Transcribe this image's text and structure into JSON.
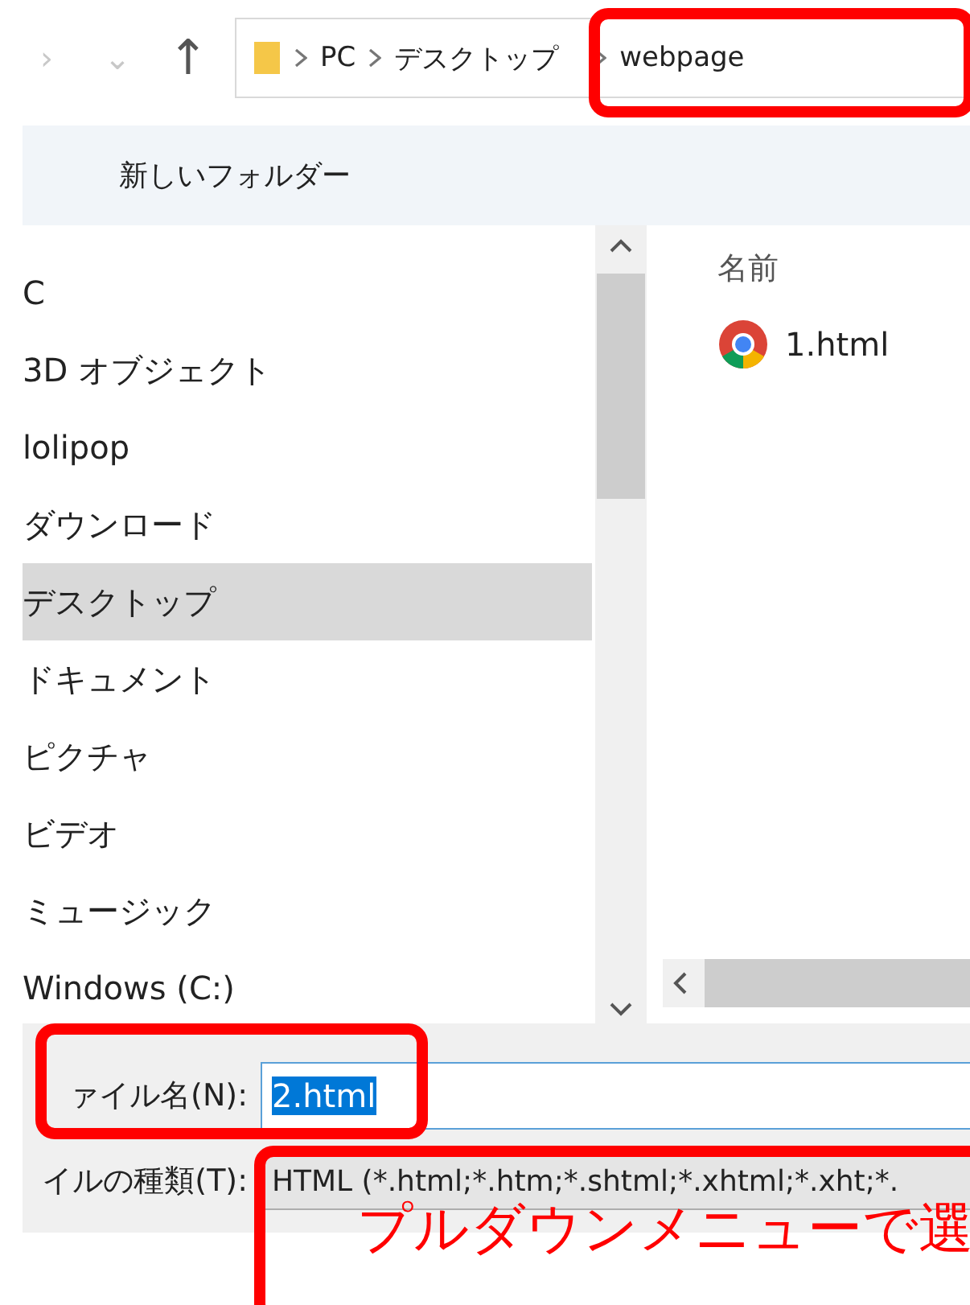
{
  "nav_buttons": {
    "back": "›",
    "forward": "⌄",
    "up": "↑"
  },
  "address_bar": {
    "segments": [
      {
        "label": "PC"
      },
      {
        "label": "デスクトップ"
      },
      {
        "label": "webpage"
      }
    ]
  },
  "toolbar": {
    "new_folder": "新しいフォルダー"
  },
  "nav_pane": {
    "items": [
      {
        "label": "C",
        "selected": false
      },
      {
        "label": "3D オブジェクト",
        "selected": false
      },
      {
        "label": "lolipop",
        "selected": false
      },
      {
        "label": "ダウンロード",
        "selected": false
      },
      {
        "label": "デスクトップ",
        "selected": true
      },
      {
        "label": "ドキュメント",
        "selected": false
      },
      {
        "label": "ピクチャ",
        "selected": false
      },
      {
        "label": "ビデオ",
        "selected": false
      },
      {
        "label": "ミュージック",
        "selected": false
      },
      {
        "label": "Windows (C:)",
        "selected": false
      }
    ]
  },
  "file_list": {
    "column": "名前",
    "files": [
      {
        "name": "1.html",
        "kind": "chrome"
      }
    ]
  },
  "file_name": {
    "label": "ァイル名(N):",
    "value": "2.html"
  },
  "file_type": {
    "label": "イルの種類(T):",
    "value": "HTML (*.html;*.htm;*.shtml;*.xhtml;*.xht;*."
  },
  "annotations": [
    {
      "kind": "address_box"
    },
    {
      "kind": "filename_box"
    },
    {
      "kind": "callout",
      "text": "プルダウンメニューで選"
    }
  ]
}
